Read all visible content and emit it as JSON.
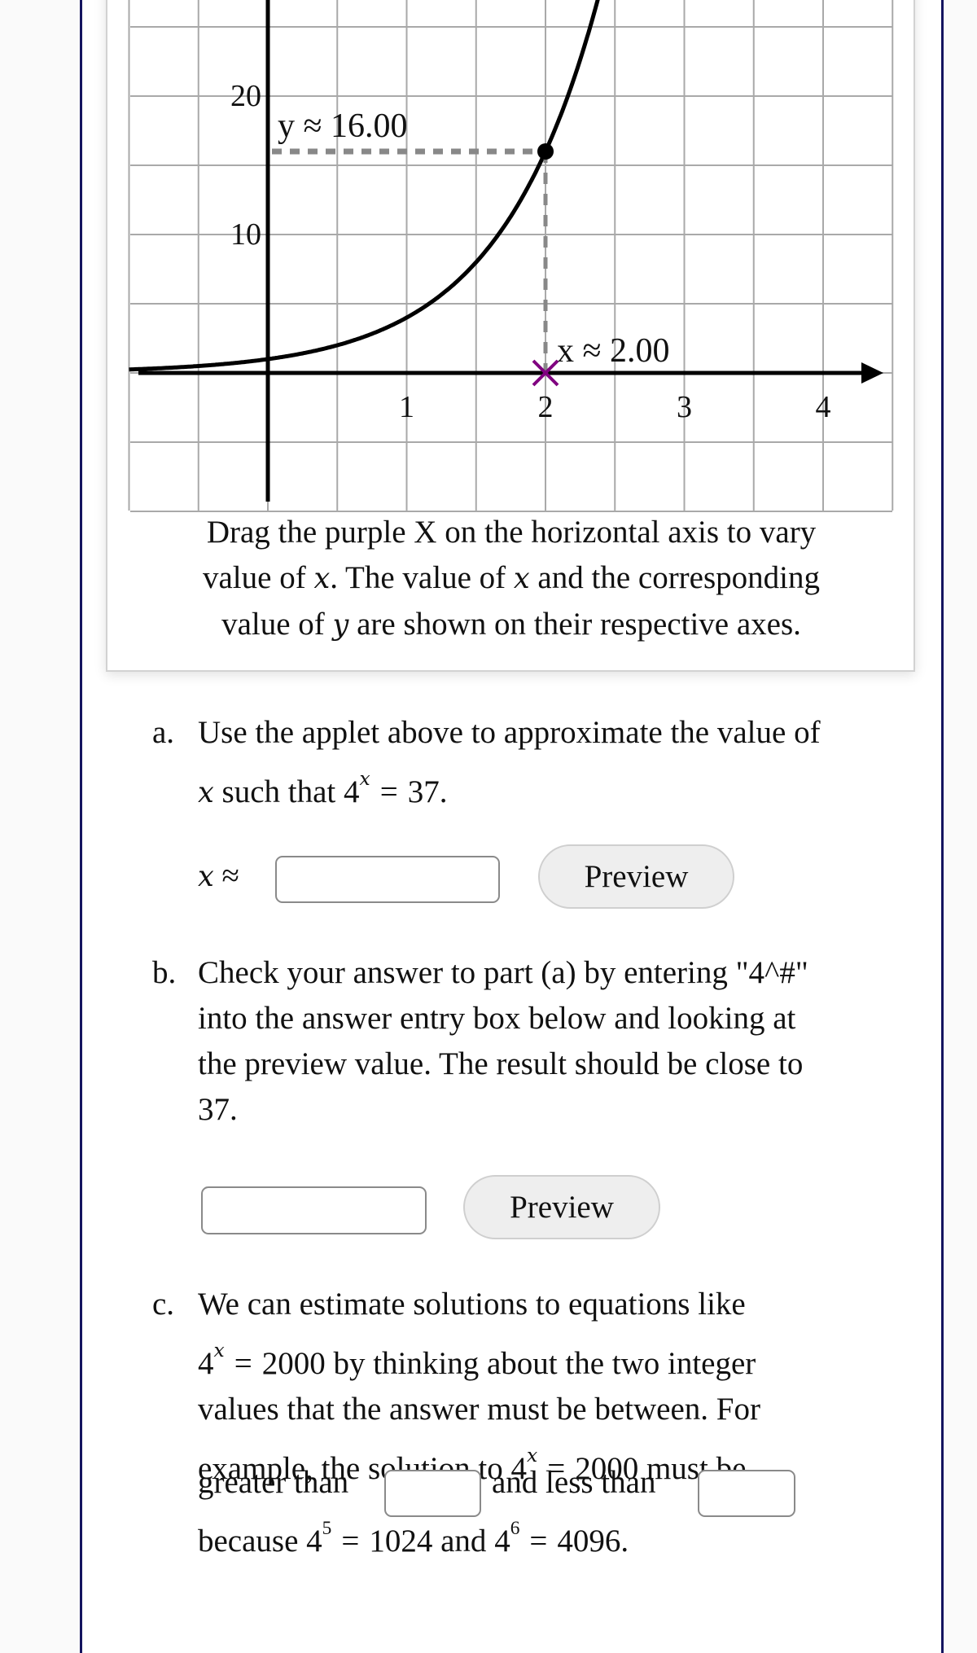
{
  "applet": {
    "caption_parts": {
      "line1": "Drag the purple X on the horizontal axis to vary",
      "line2_a": "value of ",
      "line2_var1": "x",
      "line2_b": ". The value of ",
      "line2_var2": "x",
      "line2_c": " and the corresponding",
      "line3_a": "value of ",
      "line3_var": "y",
      "line3_b": " are shown on their respective axes."
    },
    "x_readout": "x ≈ 2.00",
    "y_readout": "y ≈ 16.00",
    "colors": {
      "handle": "#800080",
      "grid": "#a9a9a9",
      "guide": "#888888",
      "curve": "#000000"
    }
  },
  "chart_data": {
    "type": "line",
    "title": "",
    "function": "y = 4^x",
    "base": 4,
    "xlabel": "",
    "ylabel": "",
    "x_range": [
      -1,
      4.5
    ],
    "y_range": [
      -10,
      27
    ],
    "x_grid_step": 0.5,
    "y_grid_step": 5,
    "x_ticks": [
      1,
      2,
      3,
      4
    ],
    "x_tick_labels": [
      "1",
      "2",
      "3",
      "4"
    ],
    "y_ticks": [
      10,
      20
    ],
    "y_tick_labels": [
      "10",
      "20"
    ],
    "grid": true,
    "selected_point": {
      "x": 2.0,
      "y": 16.0
    },
    "annotations": [
      "x ≈ 2.00",
      "y ≈ 16.00"
    ]
  },
  "part_a": {
    "marker": "a.",
    "line1": "Use the applet above to approximate the value of",
    "line2_var": "x",
    "line2_text": " such that ",
    "base": "4",
    "exp": "x",
    "equals": "=",
    "value": "37.",
    "answer_label_var": "x",
    "answer_label_sym": "≈",
    "answer_value": "",
    "preview_label": "Preview"
  },
  "part_b": {
    "marker": "b.",
    "lines": [
      "Check your answer to part (a) by entering \"4^#\"",
      "into the answer entry box below and looking at",
      "the preview value. The result should be close to",
      "37."
    ],
    "answer_value": "",
    "preview_label": "Preview"
  },
  "part_c": {
    "marker": "c.",
    "line1": "We can estimate solutions to equations like",
    "line2_base": "4",
    "line2_exp": "x",
    "line2_eq": "=",
    "line2_rest": "2000 by thinking about the two integer",
    "line3": "values that the answer must be between. For",
    "line4_a": "example, the solution to ",
    "line4_base": "4",
    "line4_exp": "x",
    "line4_eq": "=",
    "line4_b": "2000 must be",
    "line5_a": "greater than",
    "line5_b": "and less than",
    "line6_a": "because ",
    "line6_base1": "4",
    "line6_exp1": "5",
    "line6_eq1": "=",
    "line6_val1": "1024 and ",
    "line6_base2": "4",
    "line6_exp2": "6",
    "line6_eq2": "=",
    "line6_val2": "4096.",
    "lower_bound_value": "",
    "upper_bound_value": ""
  }
}
